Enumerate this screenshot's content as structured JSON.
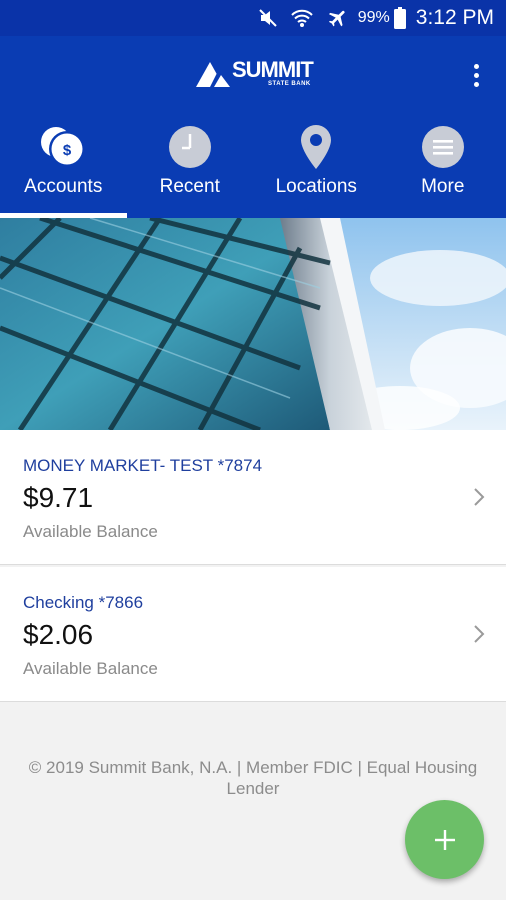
{
  "status_bar": {
    "battery_percent": "99%",
    "time": "3:12 PM",
    "icons": [
      "mute-icon",
      "wifi-icon",
      "airplane-icon",
      "battery-icon"
    ]
  },
  "header": {
    "logo": {
      "name": "SUMMIT",
      "subtitle": "STATE BANK"
    },
    "menu_icon": "more-vert-icon"
  },
  "nav": {
    "tabs": [
      {
        "label": "Accounts",
        "icon": "accounts-coins-icon",
        "active": true
      },
      {
        "label": "Recent",
        "icon": "clock-icon",
        "active": false
      },
      {
        "label": "Locations",
        "icon": "location-pin-icon",
        "active": false
      },
      {
        "label": "More",
        "icon": "menu-icon",
        "active": false
      }
    ]
  },
  "accounts": [
    {
      "name": "MONEY MARKET- TEST *7874",
      "balance": "$9.71",
      "balance_label": "Available Balance"
    },
    {
      "name": "Checking *7866",
      "balance": "$2.06",
      "balance_label": "Available Balance"
    }
  ],
  "footer": {
    "text": "© 2019 Summit Bank, N.A. | Member FDIC | Equal Housing Lender"
  },
  "fab": {
    "icon": "plus-icon",
    "color": "#6cbf68"
  },
  "colors": {
    "brand_blue": "#0a3cb3",
    "account_name": "#1f3f9e"
  }
}
